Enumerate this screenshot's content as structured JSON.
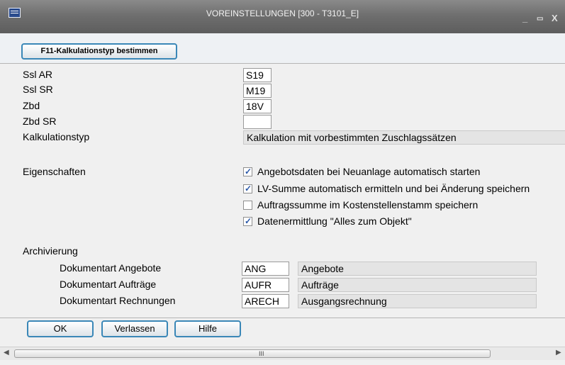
{
  "window": {
    "title": "VOREINSTELLUNGEN  [300 - T3101_E]",
    "minimize": "_",
    "maximize": "▭",
    "close": "X"
  },
  "toolbar": {
    "f11_label": "F11-Kalkulationstyp bestimmen"
  },
  "fields": {
    "ssl_ar": {
      "label": "Ssl AR",
      "value": "S19"
    },
    "ssl_sr": {
      "label": "Ssl SR",
      "value": "M19"
    },
    "zbd": {
      "label": "Zbd",
      "value": "18V"
    },
    "zbd_sr": {
      "label": "Zbd SR",
      "value": ""
    },
    "kalkulationstyp": {
      "label": "Kalkulationstyp",
      "value": "Kalkulation mit vorbestimmten Zuschlagssätzen"
    }
  },
  "eigenschaften": {
    "label": "Eigenschaften",
    "options": [
      {
        "label": "Angebotsdaten bei Neuanlage automatisch starten",
        "checked": true
      },
      {
        "label": "LV-Summe automatisch ermitteln und bei Änderung speichern",
        "checked": true
      },
      {
        "label": "Auftragssumme im Kostenstellenstamm speichern",
        "checked": false
      },
      {
        "label": "Datenermittlung \"Alles zum Objekt\"",
        "checked": true
      }
    ]
  },
  "archivierung": {
    "label": "Archivierung",
    "rows": [
      {
        "label": "Dokumentart Angebote",
        "code": "ANG",
        "description": "Angebote"
      },
      {
        "label": "Dokumentart Aufträge",
        "code": "AUFR",
        "description": "Aufträge"
      },
      {
        "label": "Dokumentart Rechnungen",
        "code": "ARECH",
        "description": "Ausgangsrechnung"
      }
    ]
  },
  "footer": {
    "ok_label": "OK",
    "exit_label": "Verlassen",
    "help_label": "Hilfe"
  },
  "scrollbar": {
    "left_arrow": "◀",
    "right_arrow": "▶",
    "grip": "III"
  }
}
